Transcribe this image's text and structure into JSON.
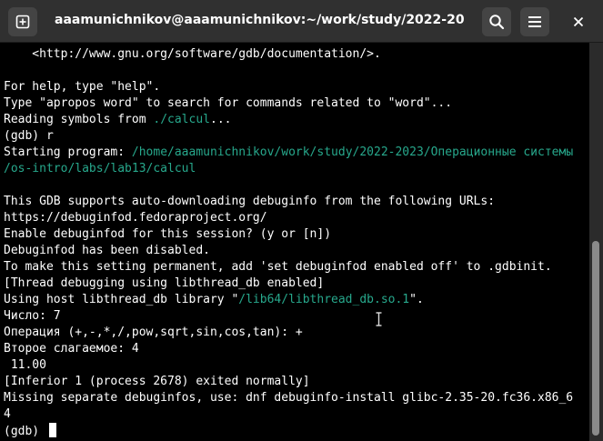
{
  "window": {
    "title": "aaamunichnikov@aaamunichnikov:~/work/study/2022-2023/О...",
    "icons": {
      "new_tab": "new-tab-icon",
      "search": "search-icon",
      "menu": "hamburger-menu-icon",
      "close": "close-icon"
    }
  },
  "terminal": {
    "lines": [
      {
        "segments": [
          {
            "text": "    <http://www.gnu.org/software/gdb/documentation/>."
          }
        ]
      },
      {
        "segments": [
          {
            "text": ""
          }
        ]
      },
      {
        "segments": [
          {
            "text": "For help, type \"help\"."
          }
        ]
      },
      {
        "segments": [
          {
            "text": "Type \"apropos word\" to search for commands related to \"word\"..."
          }
        ]
      },
      {
        "segments": [
          {
            "text": "Reading symbols from "
          },
          {
            "text": "./calcul",
            "color": "green"
          },
          {
            "text": "..."
          }
        ]
      },
      {
        "segments": [
          {
            "text": "(gdb) r"
          }
        ]
      },
      {
        "segments": [
          {
            "text": "Starting program: "
          },
          {
            "text": "/home/aaamunichnikov/work/study/2022-2023/Операционные системы",
            "color": "green"
          }
        ]
      },
      {
        "segments": [
          {
            "text": "/os-intro/labs/lab13/calcul",
            "color": "green"
          }
        ]
      },
      {
        "segments": [
          {
            "text": ""
          }
        ]
      },
      {
        "segments": [
          {
            "text": "This GDB supports auto-downloading debuginfo from the following URLs:"
          }
        ]
      },
      {
        "segments": [
          {
            "text": "https://debuginfod.fedoraproject.org/"
          }
        ]
      },
      {
        "segments": [
          {
            "text": "Enable debuginfod for this session? (y or [n])"
          }
        ]
      },
      {
        "segments": [
          {
            "text": "Debuginfod has been disabled."
          }
        ]
      },
      {
        "segments": [
          {
            "text": "To make this setting permanent, add 'set debuginfod enabled off' to .gdbinit."
          }
        ]
      },
      {
        "segments": [
          {
            "text": "[Thread debugging using libthread_db enabled]"
          }
        ]
      },
      {
        "segments": [
          {
            "text": "Using host libthread_db library \""
          },
          {
            "text": "/lib64/libthread_db.so.1",
            "color": "green"
          },
          {
            "text": "\"."
          }
        ]
      },
      {
        "segments": [
          {
            "text": "Число: 7"
          }
        ]
      },
      {
        "segments": [
          {
            "text": "Операция (+,-,*,/,pow,sqrt,sin,cos,tan): +"
          }
        ]
      },
      {
        "segments": [
          {
            "text": "Второе слагаемое: 4"
          }
        ]
      },
      {
        "segments": [
          {
            "text": " 11.00"
          }
        ]
      },
      {
        "segments": [
          {
            "text": "[Inferior 1 (process 2678) exited normally]"
          }
        ]
      },
      {
        "segments": [
          {
            "text": "Missing separate debuginfos, use: dnf debuginfo-install glibc-2.35-20.fc36.x86_6"
          }
        ]
      },
      {
        "segments": [
          {
            "text": "4"
          }
        ]
      },
      {
        "segments": [
          {
            "text": "(gdb) "
          }
        ],
        "cursor": true
      }
    ],
    "colors": {
      "background": "#000000",
      "foreground": "#ffffff",
      "green": "#27a88c"
    }
  }
}
